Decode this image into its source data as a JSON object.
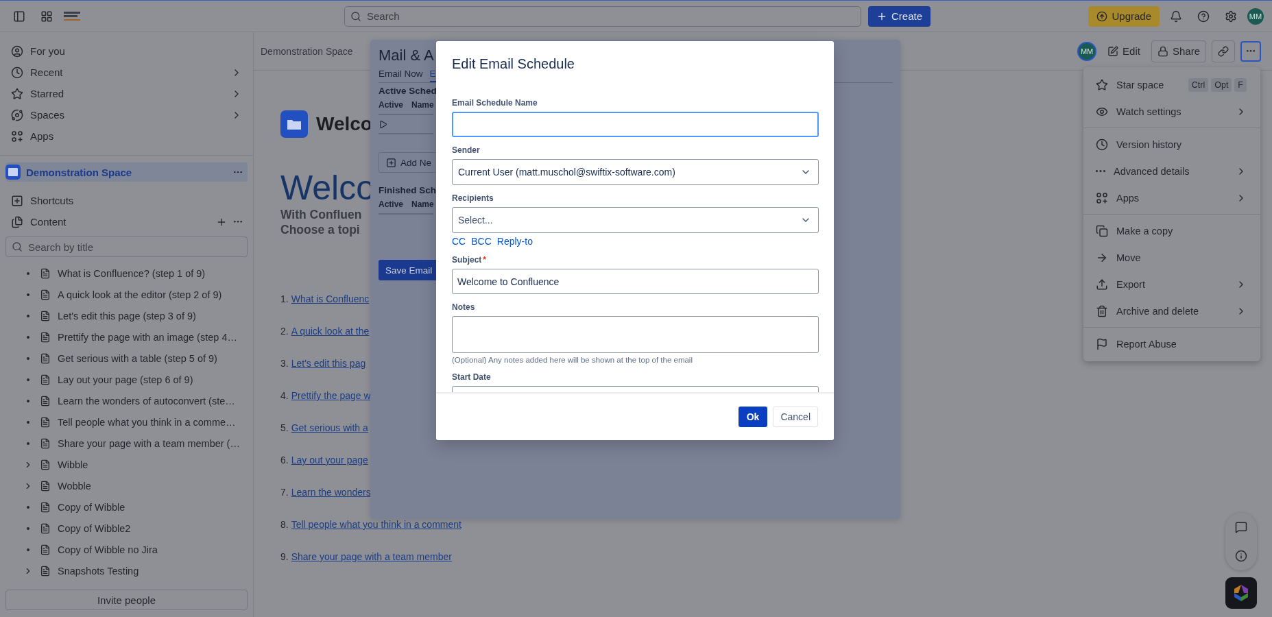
{
  "topbar": {
    "search_placeholder": "Search",
    "create": "Create",
    "upgrade": "Upgrade",
    "avatar": "MM"
  },
  "sidebar": {
    "nav": [
      {
        "label": "For you",
        "chevron": false
      },
      {
        "label": "Recent",
        "chevron": true
      },
      {
        "label": "Starred",
        "chevron": true
      },
      {
        "label": "Spaces",
        "chevron": true
      },
      {
        "label": "Apps",
        "chevron": false
      }
    ],
    "space": {
      "label": "Demonstration Space",
      "selected": true
    },
    "sections": [
      {
        "label": "Shortcuts",
        "actions": false
      },
      {
        "label": "Content",
        "actions": true
      }
    ],
    "search_placeholder": "Search by title",
    "tree": [
      {
        "label": "What is Confluence? (step 1 of 9)",
        "kind": "leaf"
      },
      {
        "label": "A quick look at the editor (step 2 of 9)",
        "kind": "leaf"
      },
      {
        "label": "Let's edit this page (step 3 of 9)",
        "kind": "leaf"
      },
      {
        "label": "Prettify the page with an image (step 4…",
        "kind": "leaf"
      },
      {
        "label": "Get serious with a table (step 5 of 9)",
        "kind": "leaf"
      },
      {
        "label": "Lay out your page (step 6 of 9)",
        "kind": "leaf"
      },
      {
        "label": "Learn the wonders of autoconvert (ste…",
        "kind": "leaf"
      },
      {
        "label": "Tell people what you think in a comme…",
        "kind": "leaf"
      },
      {
        "label": "Share your page with a team member (…",
        "kind": "leaf"
      },
      {
        "label": "Wibble",
        "kind": "parent"
      },
      {
        "label": "Wobble",
        "kind": "parent"
      },
      {
        "label": "Copy of Wibble",
        "kind": "leaf"
      },
      {
        "label": "Copy of Wibble2",
        "kind": "leaf"
      },
      {
        "label": "Copy of Wibble no Jira",
        "kind": "leaf"
      },
      {
        "label": "Snapshots Testing",
        "kind": "parent"
      }
    ],
    "invite": "Invite people"
  },
  "breadcrumb": "Demonstration Space",
  "page_actions": {
    "avatar": "MM",
    "edit": "Edit",
    "share": "Share"
  },
  "page": {
    "title": "Welco",
    "heading": "Welco",
    "subtitle_lines": [
      "With Confluen",
      "Choose a topi"
    ],
    "links": [
      {
        "number": "1.",
        "text": "What is Confluenc"
      },
      {
        "number": "2.",
        "text": "A quick look at the"
      },
      {
        "number": "3.",
        "text": "Let's edit this pag"
      },
      {
        "number": "4.",
        "text": "Prettify the page w"
      },
      {
        "number": "5.",
        "text": "Get serious with a"
      },
      {
        "number": "6.",
        "text": "Lay out your page"
      },
      {
        "number": "7.",
        "text": "Learn the wonders"
      },
      {
        "number": "8.",
        "text": "Tell people what you think in a comment"
      },
      {
        "number": "9.",
        "text": "Share your page with a team member"
      }
    ]
  },
  "mail_panel": {
    "title": "Mail & A",
    "tabs": [
      {
        "label": "Email Now",
        "selected": false
      },
      {
        "label": "E",
        "selected": true
      }
    ],
    "active_section": "Active Sched",
    "active_columns": [
      "Active",
      "Name"
    ],
    "add_button": "Add Ne",
    "finished_section": "Finished Sch",
    "finished_columns": [
      "Active",
      "Name"
    ],
    "save_button": "Save Email"
  },
  "menu_groups": [
    {
      "items": [
        {
          "label": "Star space",
          "submenu": false,
          "keys": [
            "Ctrl",
            "Opt",
            "F"
          ]
        },
        {
          "label": "Watch settings",
          "submenu": true
        }
      ]
    },
    {
      "items": [
        {
          "label": "Version history",
          "submenu": false
        },
        {
          "label": "Advanced details",
          "submenu": true
        },
        {
          "label": "Apps",
          "submenu": true
        }
      ]
    },
    {
      "items": [
        {
          "label": "Make a copy",
          "submenu": false
        },
        {
          "label": "Move",
          "submenu": false
        },
        {
          "label": "Export",
          "submenu": true
        },
        {
          "label": "Archive and delete",
          "submenu": true
        }
      ]
    },
    {
      "items": [
        {
          "label": "Report Abuse",
          "submenu": false
        }
      ]
    }
  ],
  "modal": {
    "title": "Edit Email Schedule",
    "fields": [
      {
        "kind": "text",
        "label": "Email Schedule Name",
        "focused": true
      },
      {
        "kind": "select",
        "label": "Sender",
        "value": "Current User (matt.muschol@swiftix-software.com)",
        "focused": false
      },
      {
        "kind": "select",
        "label": "Recipients",
        "placeholder": "Select...",
        "focused": false,
        "links": [
          "CC",
          "BCC",
          "Reply-to"
        ]
      },
      {
        "kind": "text",
        "label": "Subject",
        "value": "Welcome to Confluence",
        "focused": false,
        "required_mark": "*"
      },
      {
        "kind": "textarea",
        "label": "Notes",
        "focused": false,
        "help": "(Optional) Any notes added here will be shown at the top of the email"
      },
      {
        "kind": "text",
        "label": "Start Date",
        "focused": false
      }
    ],
    "ok": "Ok",
    "cancel": "Cancel"
  }
}
